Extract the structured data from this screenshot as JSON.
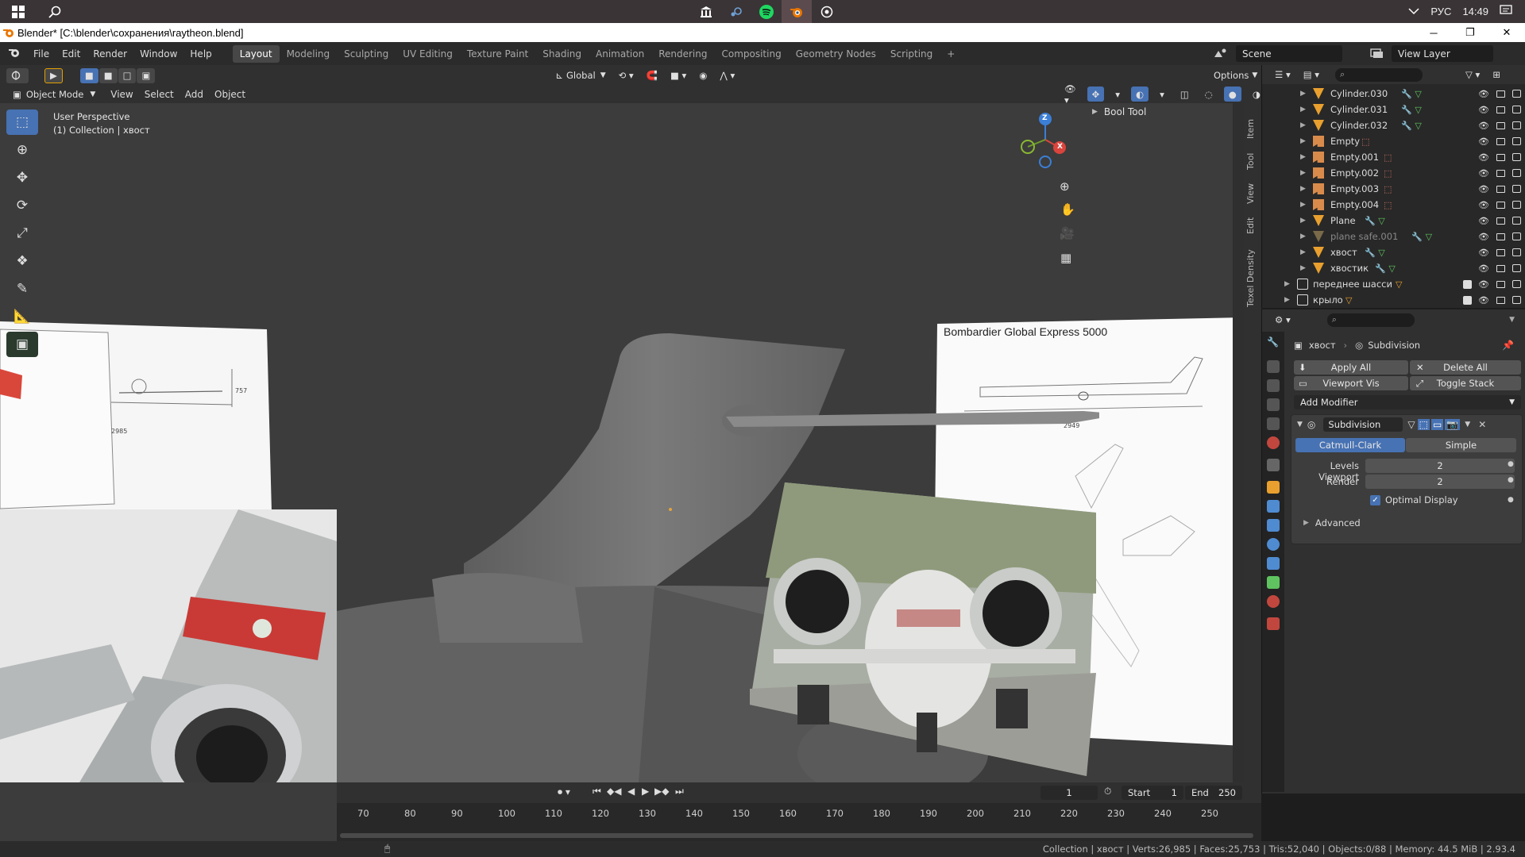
{
  "taskbar": {
    "language": "РУС",
    "time": "14:49",
    "start_icon": "windows-logo-icon",
    "search_icon": "search-icon"
  },
  "window": {
    "title": "Blender* [C:\\blender\\сохранения\\raytheon.blend]"
  },
  "menu": {
    "items": [
      "File",
      "Edit",
      "Render",
      "Window",
      "Help"
    ],
    "workspaces": [
      "Layout",
      "Modeling",
      "Sculpting",
      "UV Editing",
      "Texture Paint",
      "Shading",
      "Animation",
      "Rendering",
      "Compositing",
      "Geometry Nodes",
      "Scripting"
    ],
    "active_workspace": "Layout",
    "scene": "Scene",
    "view_layer": "View Layer"
  },
  "viewport_header": {
    "mode": "Object Mode",
    "menus": [
      "View",
      "Select",
      "Add",
      "Object"
    ],
    "transform_orientation": "Global",
    "options": "Options"
  },
  "viewport": {
    "perspective": "User Perspective",
    "collection_info": "(1) Collection | хвост",
    "npanel_section": "Bool Tool",
    "npanel_tabs": [
      "Item",
      "Tool",
      "View",
      "Edit",
      "Texel Density"
    ],
    "ref_image_caption": "Bombardier Global Express 5000",
    "ref_dim_1": "757",
    "ref_dim_2": "2985",
    "ref_dim_3": "2949",
    "gizmo_axes": [
      "Z",
      "X"
    ]
  },
  "outliner": {
    "rows": [
      {
        "name": "Cylinder.030",
        "type": "mesh"
      },
      {
        "name": "Cylinder.031",
        "type": "mesh"
      },
      {
        "name": "Cylinder.032",
        "type": "mesh"
      },
      {
        "name": "Empty",
        "type": "empty"
      },
      {
        "name": "Empty.001",
        "type": "empty"
      },
      {
        "name": "Empty.002",
        "type": "empty"
      },
      {
        "name": "Empty.003",
        "type": "empty"
      },
      {
        "name": "Empty.004",
        "type": "empty"
      },
      {
        "name": "Plane",
        "type": "mesh"
      },
      {
        "name": "plane safe.001",
        "type": "mesh-hidden"
      },
      {
        "name": "хвост",
        "type": "mesh"
      },
      {
        "name": "хвостик",
        "type": "mesh"
      },
      {
        "name": "переднее шасси",
        "type": "collection"
      },
      {
        "name": "крыло",
        "type": "collection"
      }
    ]
  },
  "properties": {
    "object_name": "хвост",
    "modifier_name_header": "Subdivision",
    "apply_all": "Apply All",
    "delete_all": "Delete All",
    "viewport_vis": "Viewport Vis",
    "toggle_stack": "Toggle Stack",
    "add_modifier": "Add Modifier",
    "modifier": {
      "name": "Subdivision",
      "mode_catmull": "Catmull-Clark",
      "mode_simple": "Simple",
      "levels_viewport_label": "Levels Viewport",
      "levels_viewport": "2",
      "render_label": "Render",
      "render": "2",
      "optimal_display": "Optimal Display",
      "advanced": "Advanced"
    }
  },
  "timeline": {
    "current_frame": "1",
    "start_label": "Start",
    "start": "1",
    "end_label": "End",
    "end": "250",
    "ticks": [
      "70",
      "80",
      "90",
      "100",
      "110",
      "120",
      "130",
      "140",
      "150",
      "160",
      "170",
      "180",
      "190",
      "200",
      "210",
      "220",
      "230",
      "240",
      "250"
    ]
  },
  "statusbar": {
    "text": "Collection | хвост | Verts:26,985 | Faces:25,753 | Tris:52,040 | Objects:0/88 | Memory: 44.5 MiB | 2.93.4"
  },
  "colors": {
    "accent": "#4772b3",
    "mesh_icon": "#e9a02e",
    "empty_icon": "#e57d6b",
    "modifier_icon": "#4f8bd1",
    "data_icon": "#5fc45f"
  }
}
